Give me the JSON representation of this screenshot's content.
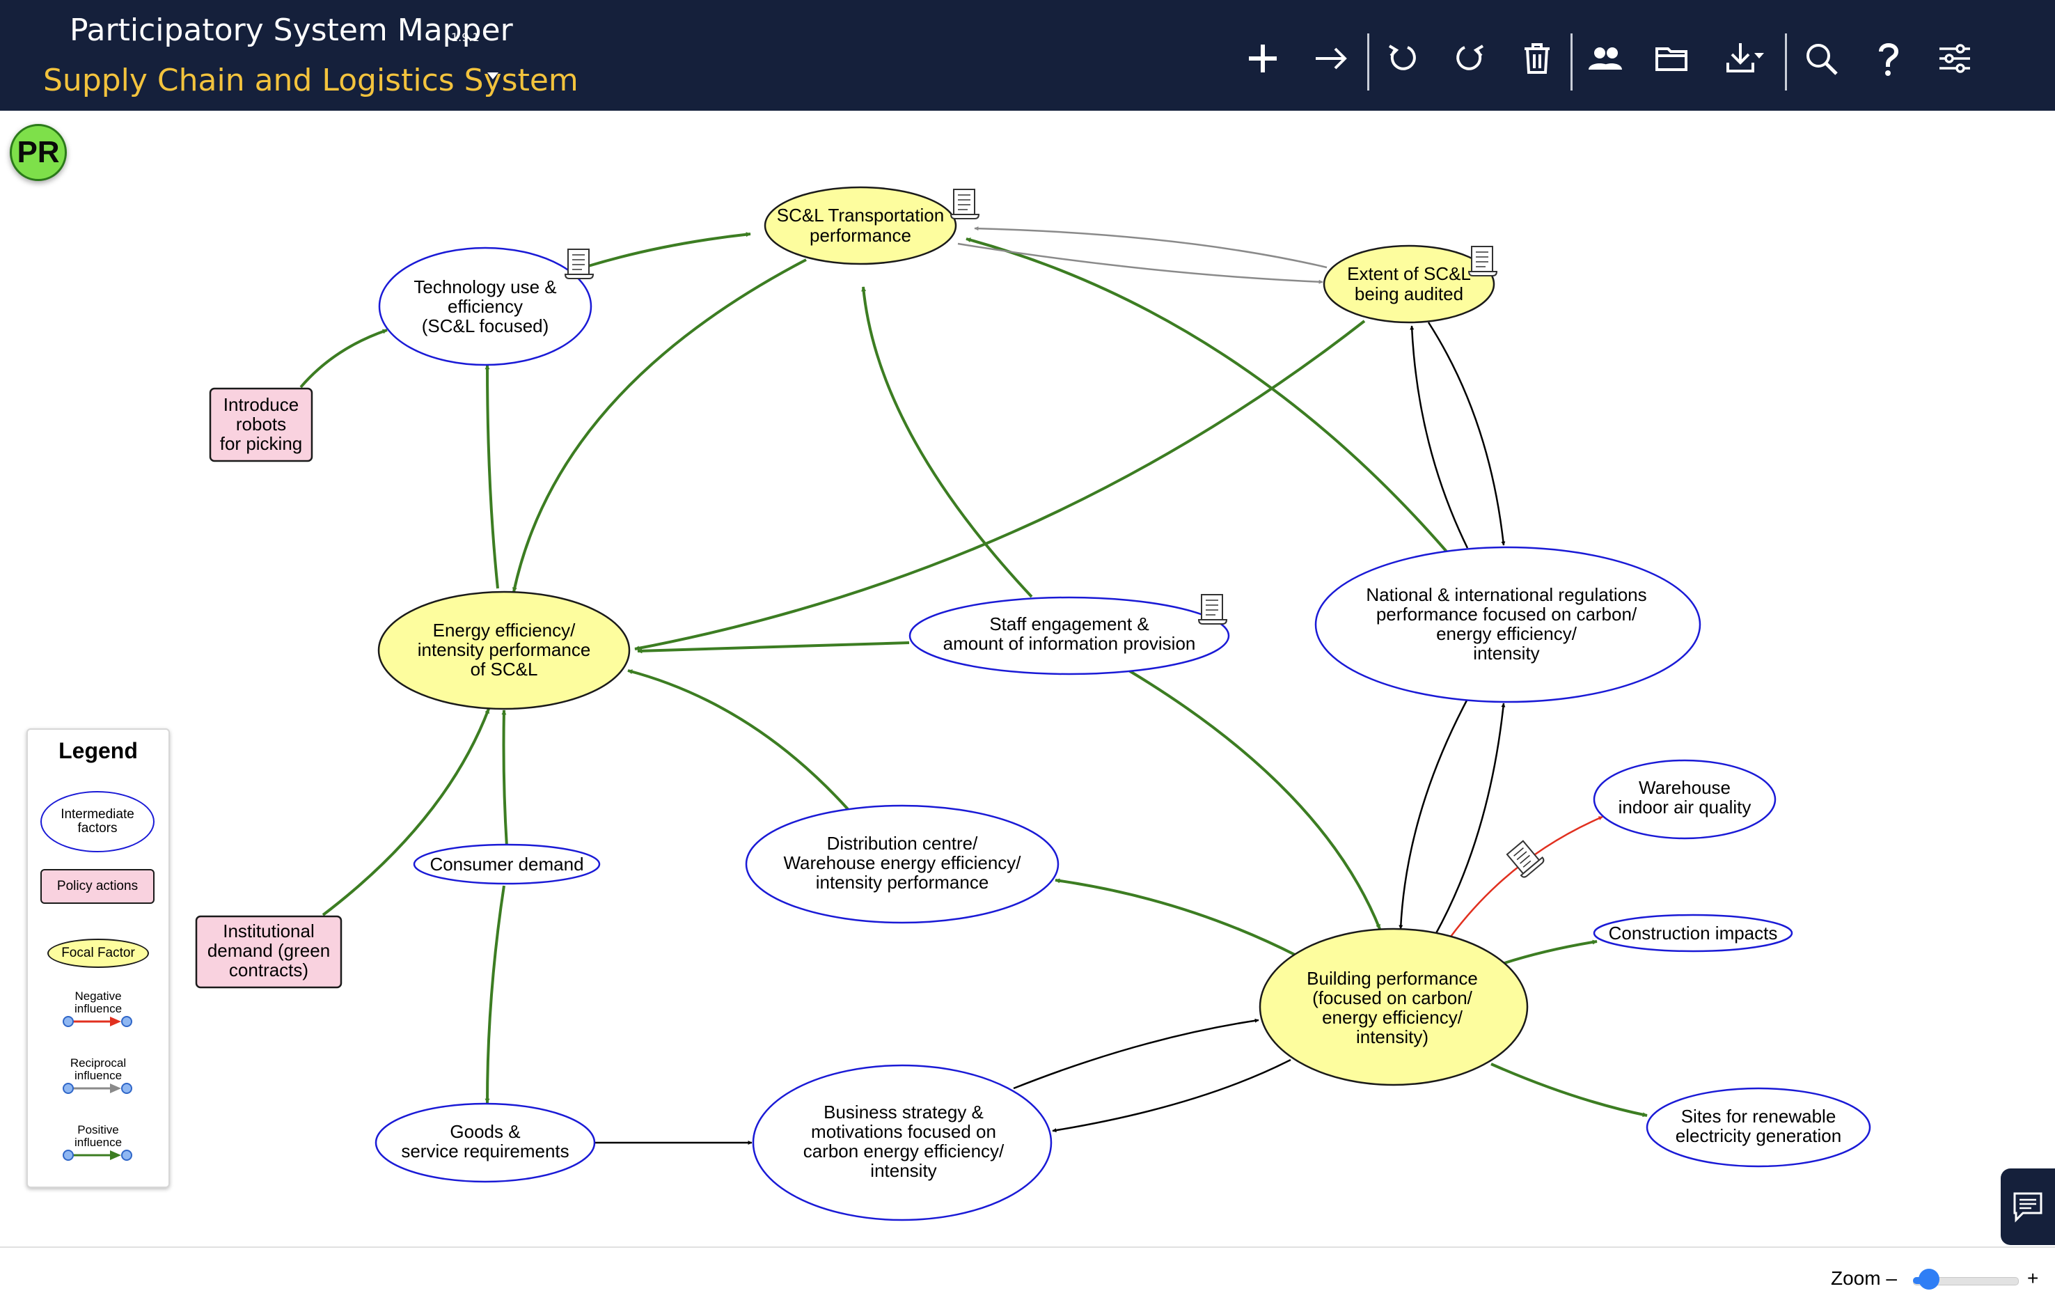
{
  "app": {
    "title": "Participatory System Mapper",
    "version": "1.9.1",
    "map_title": "Supply Chain and Logistics System"
  },
  "toolbar": [
    {
      "name": "add-node-button",
      "icon": "plus-icon"
    },
    {
      "name": "add-link-button",
      "icon": "arrow-right-icon"
    },
    {
      "name": "undo-button",
      "icon": "undo-icon"
    },
    {
      "name": "redo-button",
      "icon": "redo-icon"
    },
    {
      "name": "delete-button",
      "icon": "trash-icon"
    },
    {
      "name": "share-button",
      "icon": "users-icon"
    },
    {
      "name": "open-button",
      "icon": "folder-icon"
    },
    {
      "name": "export-button",
      "icon": "download-icon"
    },
    {
      "name": "search-button",
      "icon": "search-icon"
    },
    {
      "name": "help-button",
      "icon": "question-icon"
    },
    {
      "name": "settings-button",
      "icon": "sliders-icon"
    }
  ],
  "avatar": {
    "initials": "PR"
  },
  "colors": {
    "header_bg": "#15203b",
    "map_title": "#f3c33d",
    "focal_fill": "#fdfd9e",
    "policy_fill": "#f9d2df",
    "intermediate_border": "#1a1ad6",
    "positive_link": "#3c7d22",
    "negative_link": "#e1301f",
    "reciprocal_link": "#8a8a8a"
  },
  "nodes": {
    "sctp": {
      "label": [
        "SC&L Transportation",
        "performance"
      ],
      "type": "focal",
      "note": true
    },
    "tech": {
      "label": [
        "Technology use &",
        "efficiency",
        "(SC&L focused)"
      ],
      "type": "intermediate",
      "note": true
    },
    "audit": {
      "label": [
        "Extent of SC&L",
        "being audited"
      ],
      "type": "focal",
      "note": true
    },
    "robots": {
      "label": [
        "Introduce",
        "robots",
        "for picking"
      ],
      "type": "policy"
    },
    "energy": {
      "label": [
        "Energy efficiency/",
        "intensity performance",
        "of SC&L"
      ],
      "type": "focal"
    },
    "staff": {
      "label": [
        "Staff engagement &",
        "amount of information provision"
      ],
      "type": "intermediate",
      "note": true
    },
    "regs": {
      "label": [
        "National & international regulations",
        "performance focused on carbon/",
        "energy efficiency/",
        "intensity"
      ],
      "type": "intermediate"
    },
    "consumer": {
      "label": [
        "Consumer demand"
      ],
      "type": "intermediate"
    },
    "dc": {
      "label": [
        "Distribution centre/",
        "Warehouse energy efficiency/",
        "intensity performance"
      ],
      "type": "intermediate"
    },
    "air": {
      "label": [
        "Warehouse",
        "indoor air quality"
      ],
      "type": "intermediate"
    },
    "institutional": {
      "label": [
        "Institutional",
        "demand (green",
        "contracts)"
      ],
      "type": "policy"
    },
    "construction": {
      "label": [
        "Construction impacts"
      ],
      "type": "intermediate"
    },
    "building": {
      "label": [
        "Building performance",
        "(focused on carbon/",
        "energy efficiency/",
        "intensity)"
      ],
      "type": "focal"
    },
    "goods": {
      "label": [
        "Goods &",
        "service requirements"
      ],
      "type": "intermediate"
    },
    "business": {
      "label": [
        "Business strategy &",
        "motivations focused on",
        "carbon energy efficiency/",
        "intensity"
      ],
      "type": "intermediate"
    },
    "sites": {
      "label": [
        "Sites for renewable",
        "electricity generation"
      ],
      "type": "intermediate"
    }
  },
  "legend": {
    "title": "Legend",
    "intermediate": [
      "Intermediate",
      "factors"
    ],
    "policy": "Policy actions",
    "focal": "Focal Factor",
    "negative": [
      "Negative",
      "influence"
    ],
    "reciprocal": [
      "Reciprocal",
      "influence"
    ],
    "positive": [
      "Positive",
      "influence"
    ]
  },
  "zoom": {
    "label": "Zoom –",
    "plus": "+",
    "level": 0.15
  }
}
